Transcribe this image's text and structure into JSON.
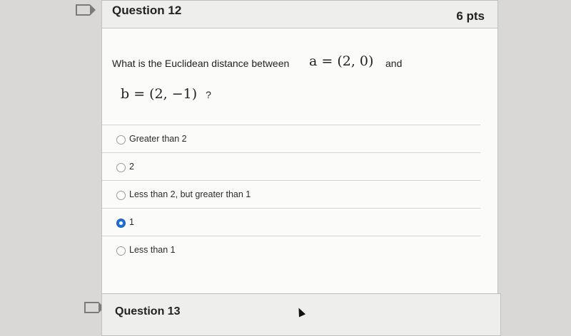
{
  "question": {
    "title": "Question 12",
    "points": "6 pts",
    "stem_text": "What is the Euclidean distance between",
    "math_a": "a = (2, 0)",
    "conj": "and",
    "math_b": "b = (2, −1)",
    "qmark": "?"
  },
  "answers": [
    {
      "label": "Greater than 2",
      "selected": false
    },
    {
      "label": "2",
      "selected": false
    },
    {
      "label": "Less than 2, but greater than 1",
      "selected": false
    },
    {
      "label": "1",
      "selected": true
    },
    {
      "label": "Less than 1",
      "selected": false
    }
  ],
  "next_question": {
    "title": "Question 13"
  },
  "colors": {
    "selected_radio": "#1e6fd9",
    "page_bg": "#d9d8d6",
    "card_bg": "#fbfbfa"
  },
  "icons": {
    "bookmark": "bookmark-icon",
    "cursor": "mouse-pointer-icon"
  }
}
